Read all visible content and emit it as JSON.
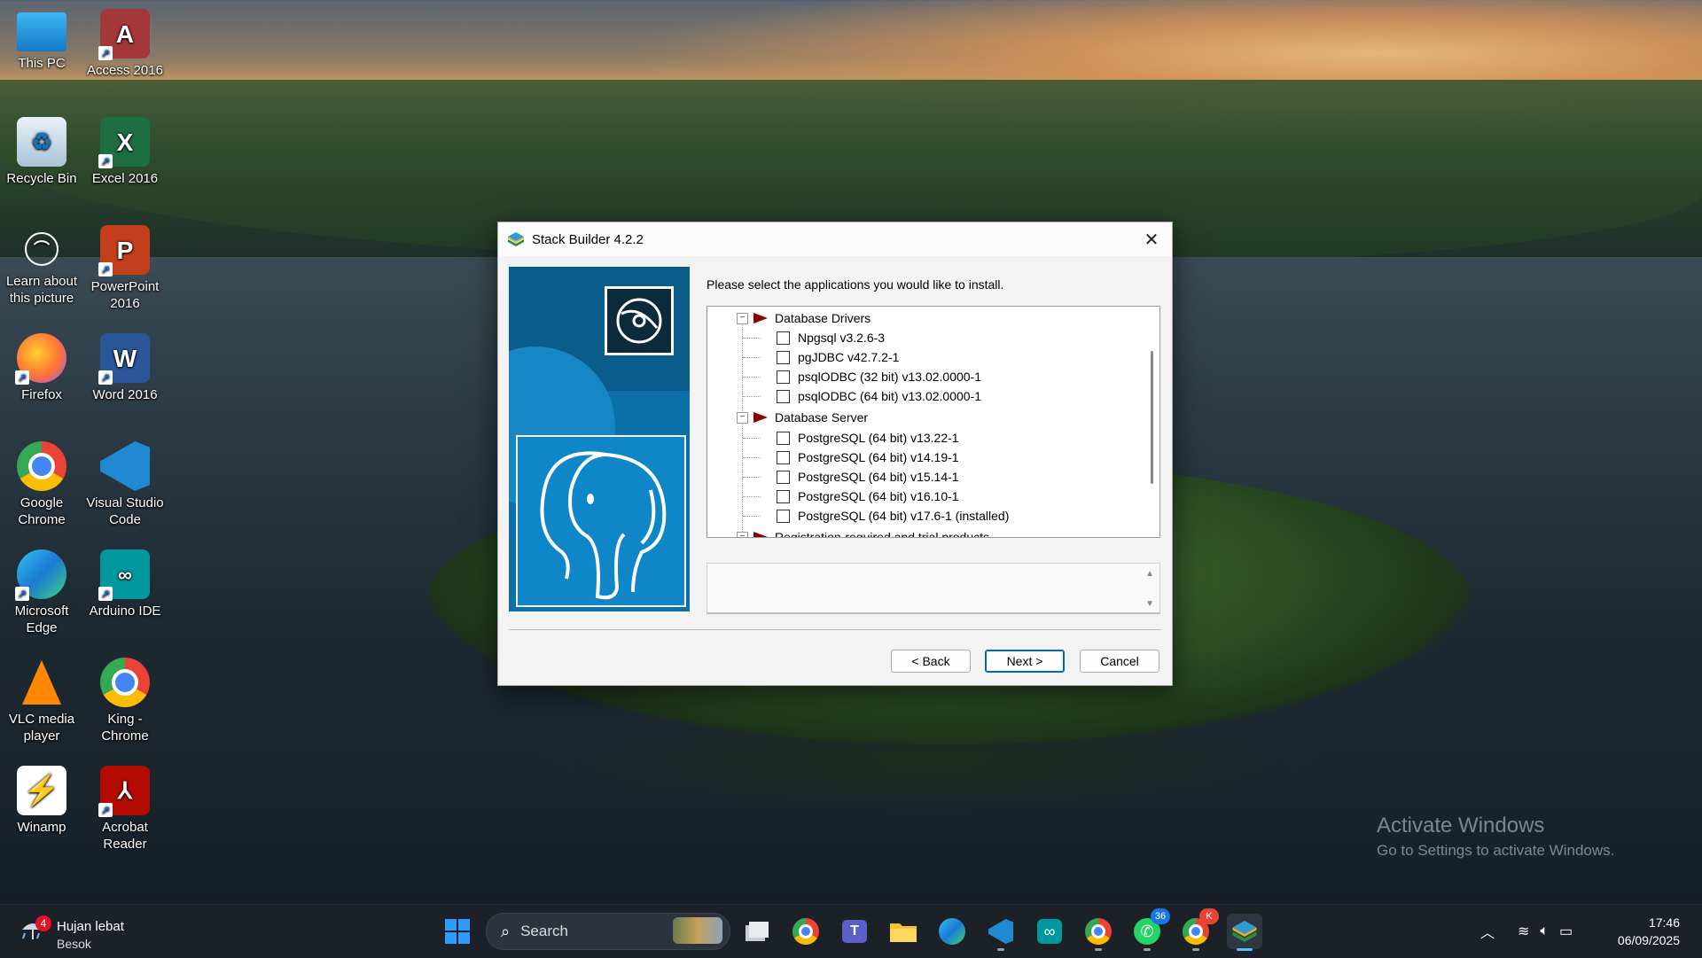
{
  "desktop": {
    "icons": [
      {
        "label": "This PC",
        "icon": "monitor-icon"
      },
      {
        "label": "Access 2016",
        "icon": "access-icon"
      },
      {
        "label": "Recycle Bin",
        "icon": "recycle-bin-icon"
      },
      {
        "label": "Excel 2016",
        "icon": "excel-icon"
      },
      {
        "label": "Learn about this picture",
        "icon": "learn-picture-icon"
      },
      {
        "label": "PowerPoint 2016",
        "icon": "powerpoint-icon"
      },
      {
        "label": "Firefox",
        "icon": "firefox-icon"
      },
      {
        "label": "Word 2016",
        "icon": "word-icon"
      },
      {
        "label": "Google Chrome",
        "icon": "chrome-icon"
      },
      {
        "label": "Visual Studio Code",
        "icon": "vscode-icon"
      },
      {
        "label": "Microsoft Edge",
        "icon": "edge-icon"
      },
      {
        "label": "Arduino IDE",
        "icon": "arduino-icon"
      },
      {
        "label": "VLC media player",
        "icon": "vlc-icon"
      },
      {
        "label": "King - Chrome",
        "icon": "chrome-profile-icon"
      },
      {
        "label": "Winamp",
        "icon": "winamp-icon"
      },
      {
        "label": "Acrobat Reader",
        "icon": "acrobat-icon"
      }
    ],
    "watermark": {
      "line1": "Activate Windows",
      "line2": "Go to Settings to activate Windows."
    }
  },
  "dialog": {
    "title": "Stack Builder 4.2.2",
    "prompt": "Please select the applications you would like to install.",
    "categories": [
      {
        "label": "Database Drivers",
        "expander": "−",
        "items": [
          "Npgsql v3.2.6-3",
          "pgJDBC v42.7.2-1",
          "psqlODBC (32 bit) v13.02.0000-1",
          "psqlODBC (64 bit) v13.02.0000-1"
        ]
      },
      {
        "label": "Database Server",
        "expander": "−",
        "items": [
          "PostgreSQL (64 bit) v13.22-1",
          "PostgreSQL (64 bit) v14.19-1",
          "PostgreSQL (64 bit) v15.14-1",
          "PostgreSQL (64 bit) v16.10-1",
          "PostgreSQL (64 bit) v17.6-1 (installed)"
        ]
      },
      {
        "label": "Registration-required and trial products",
        "expander": "−",
        "items": []
      }
    ],
    "description": "",
    "buttons": {
      "back": "< Back",
      "next": "Next >",
      "cancel": "Cancel"
    }
  },
  "taskbar": {
    "weather": {
      "badge": "4",
      "condition": "Hujan lebat",
      "day": "Besok"
    },
    "search_placeholder": "Search",
    "apps": [
      {
        "name": "task-view",
        "icon": "task-view-icon"
      },
      {
        "name": "chrome",
        "icon": "chrome-icon"
      },
      {
        "name": "teams",
        "icon": "teams-icon"
      },
      {
        "name": "file-explorer",
        "icon": "folder-icon"
      },
      {
        "name": "edge",
        "icon": "edge-icon"
      },
      {
        "name": "vscode",
        "icon": "vscode-icon"
      },
      {
        "name": "arduino",
        "icon": "arduino-icon"
      },
      {
        "name": "chrome-profile",
        "icon": "chrome-profile-icon"
      },
      {
        "name": "whatsapp",
        "icon": "whatsapp-icon",
        "badge": "36"
      },
      {
        "name": "chrome-king",
        "icon": "chrome-profile-icon",
        "badge": "K"
      },
      {
        "name": "stack-builder",
        "icon": "stack-builder-icon",
        "active": true
      }
    ],
    "clock": {
      "time": "17:46",
      "date": "06/09/2025"
    }
  },
  "colors": {
    "accent": "#0067c0",
    "category_flag": "#8b0000",
    "taskbar": "#1c2128",
    "banner": "#0b6fa8"
  }
}
